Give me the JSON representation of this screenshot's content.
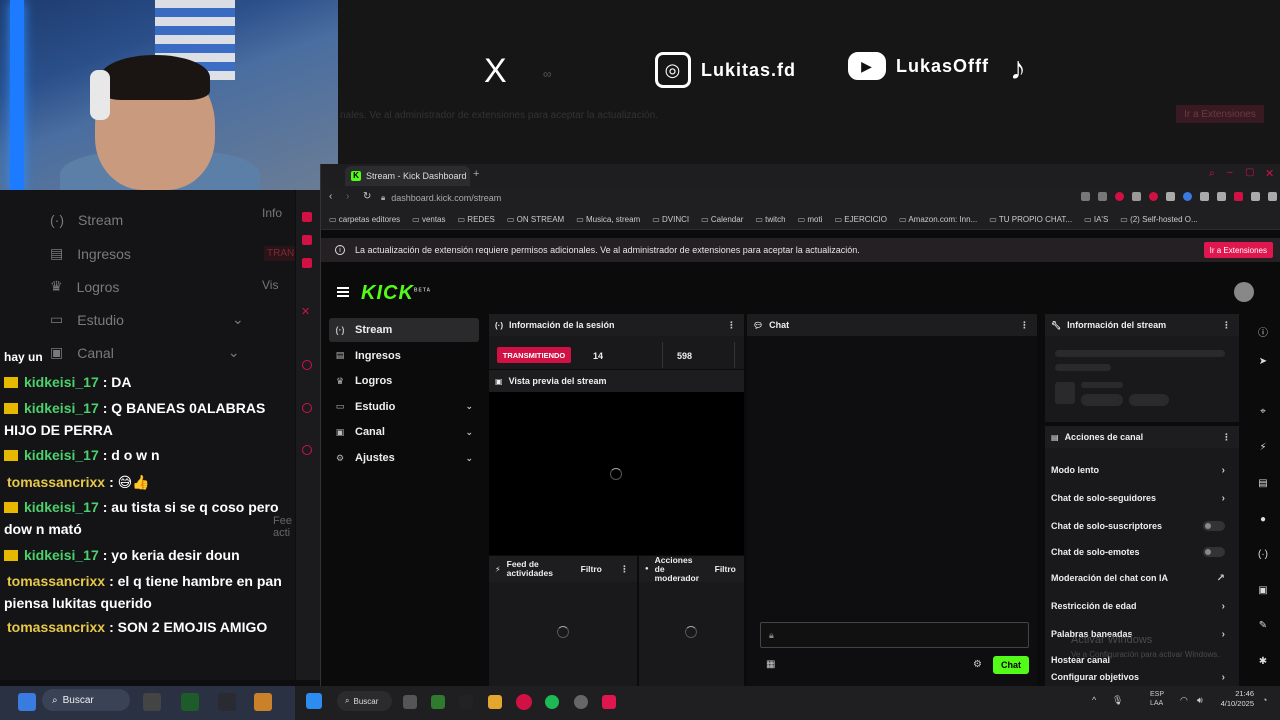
{
  "overlay": {
    "social": {
      "x_label": "X",
      "instagram_handle": "Lukitas.fd",
      "youtube_handle": "LukasOfff",
      "tiktok_label": "♪"
    },
    "faded_notice": "nales. Ve al administrador de extensiones para aceptar la actualización.",
    "faded_button": "Ir a Extensiones"
  },
  "left_panel": {
    "ghost_nav": [
      "Stream",
      "Ingresos",
      "Logros",
      "Estudio",
      "Canal"
    ],
    "ghost_side": [
      "Info",
      "TRAN",
      "Vis"
    ],
    "ghost_footer": "Fee acti",
    "partial_top": "hay un"
  },
  "chat": [
    {
      "user": "kidkeisi_17",
      "text": ": DA",
      "crown": true,
      "color": "green"
    },
    {
      "user": "kidkeisi_17",
      "text": ": Q BANEAS 0ALABRAS HIJO DE PERRA",
      "crown": true,
      "color": "green"
    },
    {
      "user": "kidkeisi_17",
      "text": ": d o w n",
      "crown": true,
      "color": "green"
    },
    {
      "user": "tomassancrixx",
      "text": ": 😅👍",
      "crown": false,
      "color": "yellow"
    },
    {
      "user": "kidkeisi_17",
      "text": ": au tista si se q coso pero dow n mató",
      "crown": true,
      "color": "green"
    },
    {
      "user": "kidkeisi_17",
      "text": ": yo keria desir doun",
      "crown": true,
      "color": "green"
    },
    {
      "user": "tomassancrixx",
      "text": ": el q tiene hambre en pan piensa lukitas querido",
      "crown": false,
      "color": "yellow"
    },
    {
      "user": "tomassancrixx",
      "text": ": SON 2 EMOJIS AMIGO",
      "crown": false,
      "color": "yellow"
    }
  ],
  "browser": {
    "tab_title": "Stream - Kick Dashboard",
    "url": "dashboard.kick.com/stream",
    "bookmarks": [
      "carpetas editores",
      "ventas",
      "REDES",
      "ON STREAM",
      "Musica, stream",
      "DVINCI",
      "Calendar",
      "twitch",
      "moti",
      "EJERCICIO",
      "Amazon.com: Inn...",
      "TU PROPIO CHAT...",
      "IA'S",
      "(2) Self-hosted O..."
    ],
    "notice": "La actualización de extensión requiere permisos adicionales. Ve al administrador de extensiones para aceptar la actualización.",
    "notice_button": "Ir a Extensiones"
  },
  "kick": {
    "logo": "KICK",
    "logo_tag": "BETA",
    "nav": [
      {
        "label": "Stream",
        "icon": "stream-icon",
        "glyph": "(·)",
        "active": true,
        "chevron": false
      },
      {
        "label": "Ingresos",
        "icon": "revenue-icon",
        "glyph": "▤",
        "active": false,
        "chevron": false
      },
      {
        "label": "Logros",
        "icon": "trophy-icon",
        "glyph": "♛",
        "active": false,
        "chevron": false
      },
      {
        "label": "Estudio",
        "icon": "studio-icon",
        "glyph": "▭",
        "active": false,
        "chevron": true
      },
      {
        "label": "Canal",
        "icon": "channel-icon",
        "glyph": "▣",
        "active": false,
        "chevron": true
      },
      {
        "label": "Ajustes",
        "icon": "gear-icon",
        "glyph": "⚙",
        "active": false,
        "chevron": true
      }
    ],
    "session_title": "Información de la sesión",
    "live_badge": "TRANSMITIENDO",
    "viewers": "14",
    "followers": "598",
    "preview_title": "Vista previa del stream",
    "feed_title": "Feed de actividades",
    "feed_filter": "Filtro",
    "mod_title": "Acciones de moderador",
    "mod_filter": "Filtro",
    "chat_title": "Chat",
    "chat_button": "Chat",
    "stream_info_title": "Información del stream",
    "channel_actions_title": "Acciones de canal",
    "actions": [
      {
        "label": "Modo lento",
        "control": "chevron"
      },
      {
        "label": "Chat de solo-seguidores",
        "control": "chevron"
      },
      {
        "label": "Chat de solo-suscriptores",
        "control": "toggle"
      },
      {
        "label": "Chat de solo-emotes",
        "control": "toggle"
      },
      {
        "label": "Moderación del chat con IA",
        "control": "external"
      },
      {
        "label": "Restricción de edad",
        "control": "chevron"
      },
      {
        "label": "Palabras baneadas",
        "control": "chevron"
      },
      {
        "label": "Hostear canal",
        "control": "none"
      },
      {
        "label": "Configurar objetivos",
        "control": "chevron"
      }
    ],
    "watermark_title": "Activar Windows",
    "watermark_sub": "Ve a Configuración para activar Windows."
  },
  "taskbar": {
    "search_left": "Buscar",
    "search_right": "Buscar",
    "lang_top": "ESP",
    "lang_bottom": "LAA",
    "time": "21:46",
    "date": "4/10/2025"
  }
}
